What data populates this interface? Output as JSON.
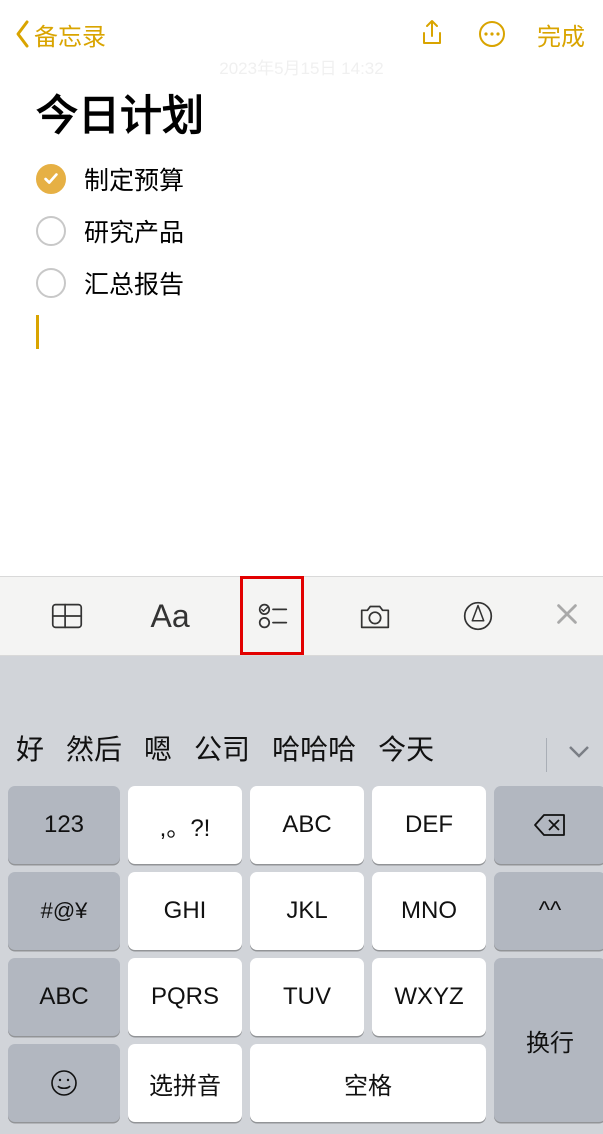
{
  "header": {
    "back_label": "备忘录",
    "done_label": "完成",
    "timestamp": "2023年5月15日 14:32"
  },
  "note": {
    "title": "今日计划",
    "items": [
      {
        "text": "制定预算",
        "checked": true
      },
      {
        "text": "研究产品",
        "checked": false
      },
      {
        "text": "汇总报告",
        "checked": false
      }
    ]
  },
  "toolbar": {
    "text_format_label": "Aa"
  },
  "candidates": [
    "好",
    "然后",
    "嗯",
    "公司",
    "哈哈哈",
    "今天"
  ],
  "keypad": {
    "r1": [
      "123",
      ",。?!",
      "ABC",
      "DEF"
    ],
    "r2": [
      "#@¥",
      "GHI",
      "JKL",
      "MNO",
      "^^"
    ],
    "r3": [
      "ABC",
      "PQRS",
      "TUV",
      "WXYZ"
    ],
    "r4_pinyin": "选拼音",
    "r4_space": "空格",
    "return_label": "换行"
  },
  "colors": {
    "accent": "#d9a400"
  }
}
